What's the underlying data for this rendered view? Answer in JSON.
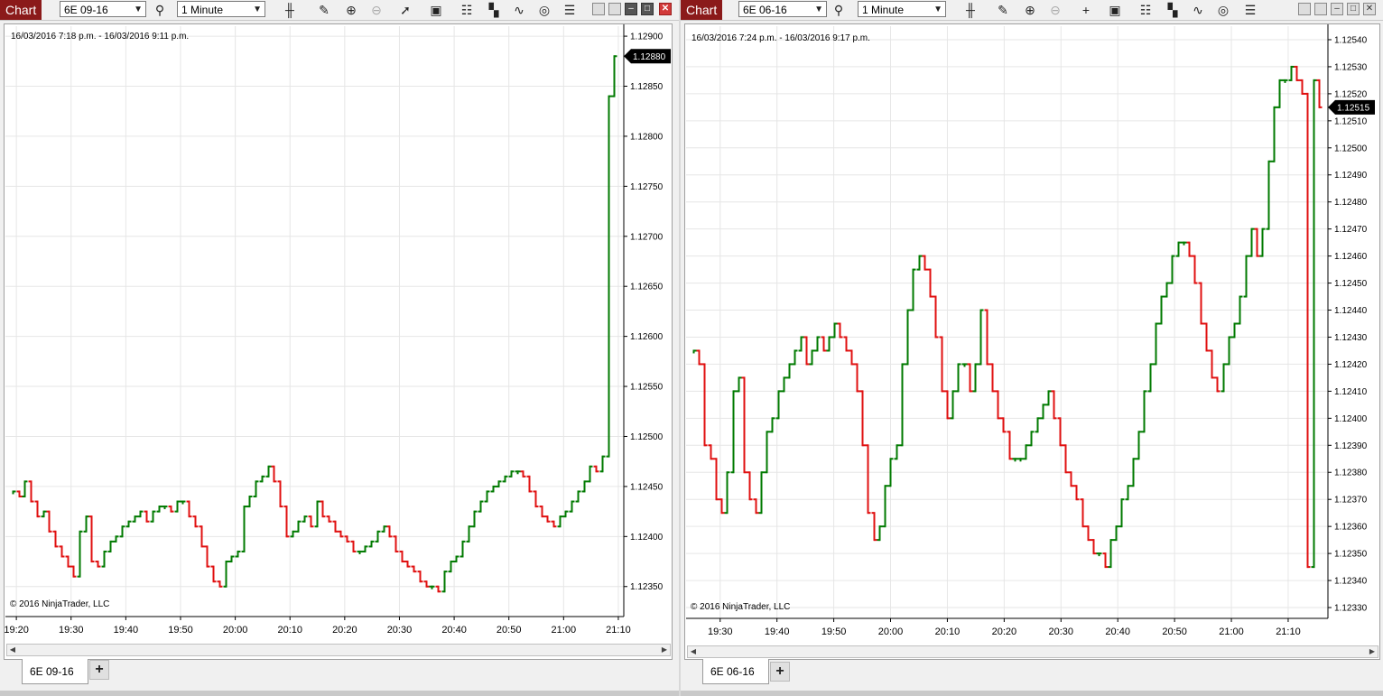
{
  "windows": [
    {
      "id": "left",
      "title": "Chart",
      "instrument": "6E 09-16",
      "interval": "1 Minute",
      "date_range": "16/03/2016 7:18 p.m. - 16/03/2016 9:11 p.m.",
      "copyright": "© 2016 NinjaTrader, LLC",
      "tab_label": "6E 09-16",
      "tab_add": "+",
      "price_marker": "1.12880",
      "colors": {
        "up": "#007a00",
        "down": "#e01010"
      }
    },
    {
      "id": "right",
      "title": "Chart",
      "instrument": "6E 06-16",
      "interval": "1 Minute",
      "date_range": "16/03/2016 7:24 p.m. - 16/03/2016 9:17 p.m.",
      "copyright": "© 2016 NinjaTrader, LLC",
      "tab_label": "6E 06-16",
      "tab_add": "+",
      "price_marker": "1.12515",
      "colors": {
        "up": "#007a00",
        "down": "#e01010"
      }
    }
  ],
  "chart_data": [
    {
      "type": "ohlc",
      "title": "6E 09-16",
      "x_ticks": [
        "19:20",
        "19:30",
        "19:40",
        "19:50",
        "20:00",
        "20:10",
        "20:20",
        "20:30",
        "20:40",
        "20:50",
        "21:00",
        "21:10"
      ],
      "y_ticks": [
        "1.12350",
        "1.12400",
        "1.12450",
        "1.12500",
        "1.12550",
        "1.12600",
        "1.12650",
        "1.12700",
        "1.12750",
        "1.12800",
        "1.12850",
        "1.12900"
      ],
      "ylim": [
        1.1232,
        1.1291
      ],
      "x_start": "19:18",
      "x_end": "21:11",
      "grid": true,
      "last_price": "1.12880",
      "closes": [
        1.12445,
        1.1244,
        1.12455,
        1.12435,
        1.1242,
        1.12425,
        1.12405,
        1.1239,
        1.1238,
        1.1237,
        1.1236,
        1.12405,
        1.1242,
        1.12375,
        1.1237,
        1.12385,
        1.12395,
        1.124,
        1.1241,
        1.12415,
        1.1242,
        1.12425,
        1.12415,
        1.12425,
        1.1243,
        1.1243,
        1.12425,
        1.12435,
        1.12435,
        1.1242,
        1.1241,
        1.1239,
        1.1237,
        1.12355,
        1.1235,
        1.12375,
        1.1238,
        1.12385,
        1.1243,
        1.1244,
        1.12455,
        1.1246,
        1.1247,
        1.12455,
        1.1243,
        1.124,
        1.12405,
        1.12415,
        1.1242,
        1.1241,
        1.12435,
        1.1242,
        1.12415,
        1.12405,
        1.124,
        1.12395,
        1.12385,
        1.12385,
        1.1239,
        1.12395,
        1.12405,
        1.1241,
        1.124,
        1.12385,
        1.12375,
        1.1237,
        1.12365,
        1.12355,
        1.1235,
        1.1235,
        1.12345,
        1.12365,
        1.12375,
        1.1238,
        1.12395,
        1.1241,
        1.12425,
        1.12435,
        1.12445,
        1.1245,
        1.12455,
        1.1246,
        1.12465,
        1.12465,
        1.1246,
        1.12445,
        1.1243,
        1.1242,
        1.12415,
        1.1241,
        1.1242,
        1.12425,
        1.12435,
        1.12445,
        1.12455,
        1.1247,
        1.12465,
        1.1248,
        1.1284,
        1.1288
      ]
    },
    {
      "type": "ohlc",
      "title": "6E 06-16",
      "x_ticks": [
        "19:30",
        "19:40",
        "19:50",
        "20:00",
        "20:10",
        "20:20",
        "20:30",
        "20:40",
        "20:50",
        "21:00",
        "21:10"
      ],
      "y_ticks": [
        "1.12330",
        "1.12340",
        "1.12350",
        "1.12360",
        "1.12370",
        "1.12380",
        "1.12390",
        "1.12400",
        "1.12410",
        "1.12420",
        "1.12430",
        "1.12440",
        "1.12450",
        "1.12460",
        "1.12470",
        "1.12480",
        "1.12490",
        "1.12500",
        "1.12510",
        "1.12520",
        "1.12530",
        "1.12540"
      ],
      "ylim": [
        1.12326,
        1.12545
      ],
      "x_start": "19:24",
      "x_end": "21:17",
      "grid": true,
      "last_price": "1.12515",
      "closes": [
        1.12425,
        1.1242,
        1.1239,
        1.12385,
        1.1237,
        1.12365,
        1.1238,
        1.1241,
        1.12415,
        1.1238,
        1.1237,
        1.12365,
        1.1238,
        1.12395,
        1.124,
        1.1241,
        1.12415,
        1.1242,
        1.12425,
        1.1243,
        1.1242,
        1.12425,
        1.1243,
        1.12425,
        1.1243,
        1.12435,
        1.1243,
        1.12425,
        1.1242,
        1.1241,
        1.1239,
        1.12365,
        1.12355,
        1.1236,
        1.12375,
        1.12385,
        1.1239,
        1.1242,
        1.1244,
        1.12455,
        1.1246,
        1.12455,
        1.12445,
        1.1243,
        1.1241,
        1.124,
        1.1241,
        1.1242,
        1.1242,
        1.1241,
        1.1242,
        1.1244,
        1.1242,
        1.1241,
        1.124,
        1.12395,
        1.12385,
        1.12385,
        1.12385,
        1.1239,
        1.12395,
        1.124,
        1.12405,
        1.1241,
        1.124,
        1.1239,
        1.1238,
        1.12375,
        1.1237,
        1.1236,
        1.12355,
        1.1235,
        1.1235,
        1.12345,
        1.12355,
        1.1236,
        1.1237,
        1.12375,
        1.12385,
        1.12395,
        1.1241,
        1.1242,
        1.12435,
        1.12445,
        1.1245,
        1.1246,
        1.12465,
        1.12465,
        1.1246,
        1.1245,
        1.12435,
        1.12425,
        1.12415,
        1.1241,
        1.1242,
        1.1243,
        1.12435,
        1.12445,
        1.1246,
        1.1247,
        1.1246,
        1.1247,
        1.12495,
        1.12515,
        1.12525,
        1.12525,
        1.1253,
        1.12525,
        1.1252,
        1.12345,
        1.12525,
        1.12515
      ]
    }
  ]
}
